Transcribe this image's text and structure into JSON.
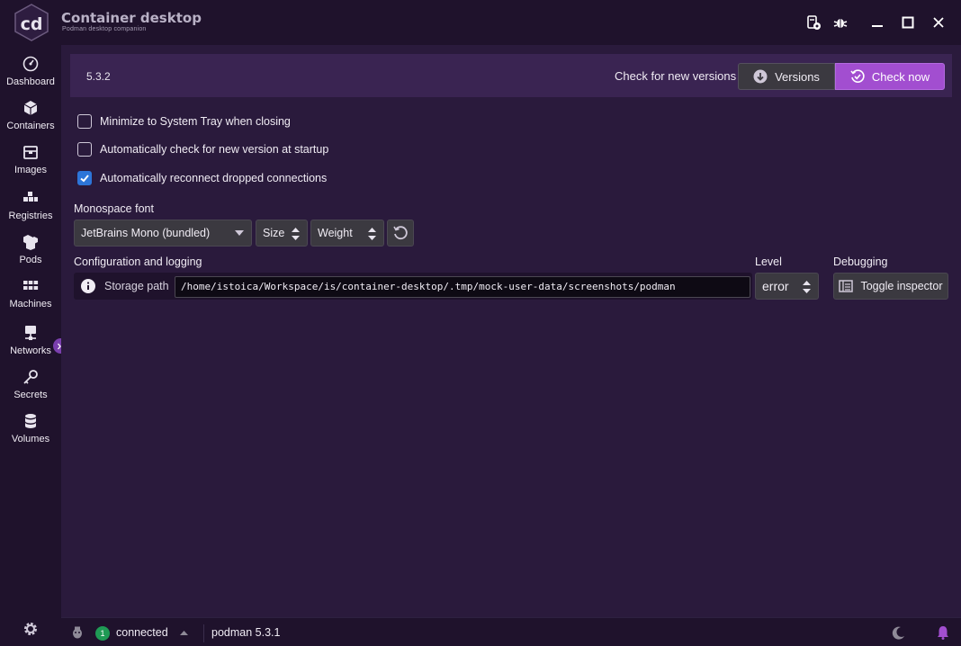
{
  "app": {
    "logo_text": "cd",
    "title": "Container desktop",
    "subtitle": "Podman desktop companion"
  },
  "sidebar": {
    "items": [
      {
        "label": "Dashboard",
        "icon": "dashboard-icon"
      },
      {
        "label": "Containers",
        "icon": "cube-icon"
      },
      {
        "label": "Images",
        "icon": "box-icon"
      },
      {
        "label": "Registries",
        "icon": "registries-icon"
      },
      {
        "label": "Pods",
        "icon": "pods-icon"
      },
      {
        "label": "Machines",
        "icon": "grid-icon"
      },
      {
        "label": "Networks",
        "icon": "network-icon"
      },
      {
        "label": "Secrets",
        "icon": "key-icon"
      },
      {
        "label": "Volumes",
        "icon": "database-icon"
      }
    ]
  },
  "settings": {
    "version": "5.3.2",
    "check_label": "Check for new versions",
    "versions_button": "Versions",
    "check_now_button": "Check now",
    "options": [
      {
        "label": "Minimize to System Tray when closing",
        "checked": false
      },
      {
        "label": "Automatically check for new version at startup",
        "checked": false
      },
      {
        "label": "Automatically reconnect dropped connections",
        "checked": true
      }
    ],
    "font_section_label": "Monospace font",
    "font_value": "JetBrains Mono (bundled)",
    "size_value": "Size",
    "weight_value": "Weight",
    "config_label": "Configuration and logging",
    "storage_label": "Storage path",
    "storage_path": "/home/istoica/Workspace/is/container-desktop/.tmp/mock-user-data/screenshots/podman",
    "level_label": "Level",
    "level_value": "error",
    "debugging_label": "Debugging",
    "toggle_inspector_button": "Toggle inspector"
  },
  "statusbar": {
    "connection_count": "1",
    "connection_status": "connected",
    "engine": "podman 5.3.1"
  },
  "colors": {
    "accent": "#a24ed0",
    "background": "#2a1a3c",
    "sidebar": "#1f122c",
    "checkbox_checked": "#2d75d8",
    "badge_green": "#1f9a55"
  }
}
